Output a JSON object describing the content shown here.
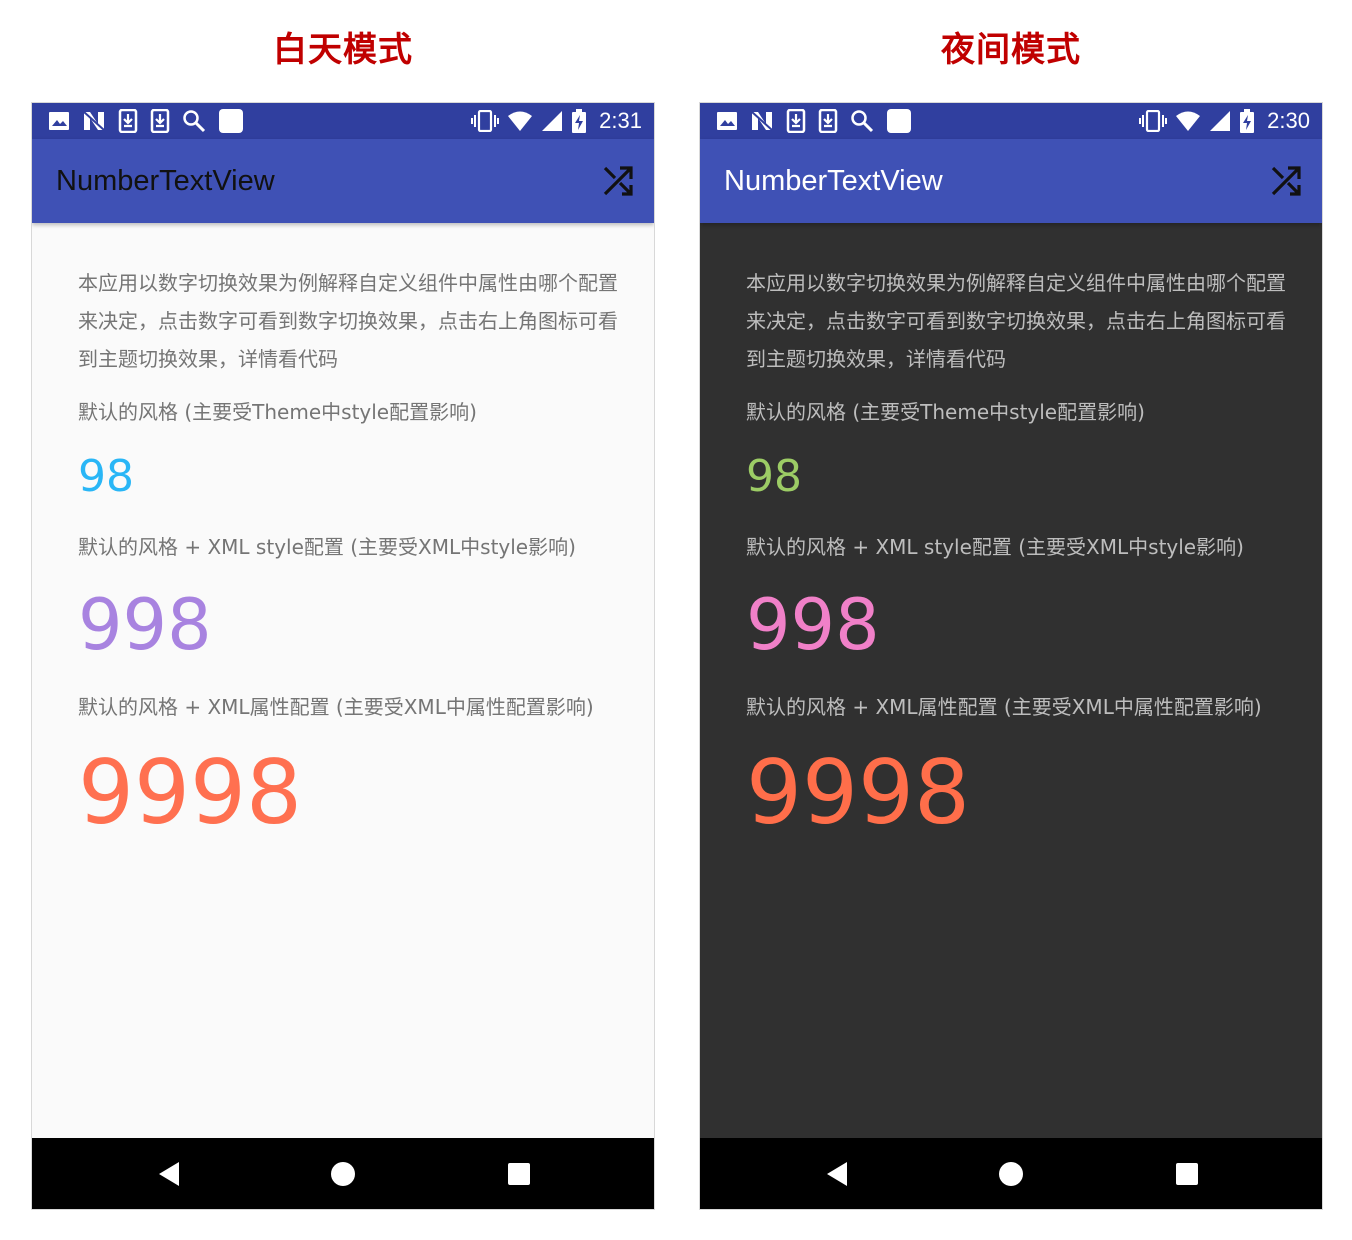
{
  "captions": {
    "day": "白天模式",
    "night": "夜间模式"
  },
  "screens": [
    {
      "mode": "day",
      "status_time": "2:31",
      "app_title": "NumberTextView",
      "description": "本应用以数字切换效果为例解释自定义组件中属性由哪个配置来决定，点击数字可看到数字切换效果，点击右上角图标可看到主题切换效果，详情看代码",
      "label1": "默认的风格 (主要受Theme中style配置影响)",
      "value1": "98",
      "label2": "默认的风格 + XML style配置 (主要受XML中style影响)",
      "value2": "998",
      "label3": "默认的风格 + XML属性配置 (主要受XML中属性配置影响)",
      "value3": "9998",
      "colors": {
        "background": "#fafafa",
        "value1": "#29b6f6",
        "value2": "#a883e0",
        "value3": "#ff7050"
      }
    },
    {
      "mode": "night",
      "status_time": "2:30",
      "app_title": "NumberTextView",
      "description": "本应用以数字切换效果为例解释自定义组件中属性由哪个配置来决定，点击数字可看到数字切换效果，点击右上角图标可看到主题切换效果，详情看代码",
      "label1": "默认的风格 (主要受Theme中style配置影响)",
      "value1": "98",
      "label2": "默认的风格 + XML style配置 (主要受XML中style影响)",
      "value2": "998",
      "label3": "默认的风格 + XML属性配置 (主要受XML中属性配置影响)",
      "value3": "9998",
      "colors": {
        "background": "#303030",
        "value1": "#9ccc65",
        "value2": "#f080c8",
        "value3": "#ff6e4a"
      }
    }
  ],
  "theme": {
    "status_bar": "#303f9f",
    "app_bar": "#3f51b5",
    "nav_bar": "#000000",
    "caption_color": "#c00000"
  },
  "icons": {
    "status_left": [
      "image-icon",
      "n-logo-icon",
      "download-icon",
      "download-icon",
      "search-icon",
      "square-icon"
    ],
    "status_right": [
      "vibrate-icon",
      "wifi-icon",
      "signal-icon",
      "battery-charging-icon"
    ],
    "app_bar_action": "shuffle-icon",
    "nav": [
      "back-icon",
      "home-icon",
      "recents-icon"
    ]
  }
}
